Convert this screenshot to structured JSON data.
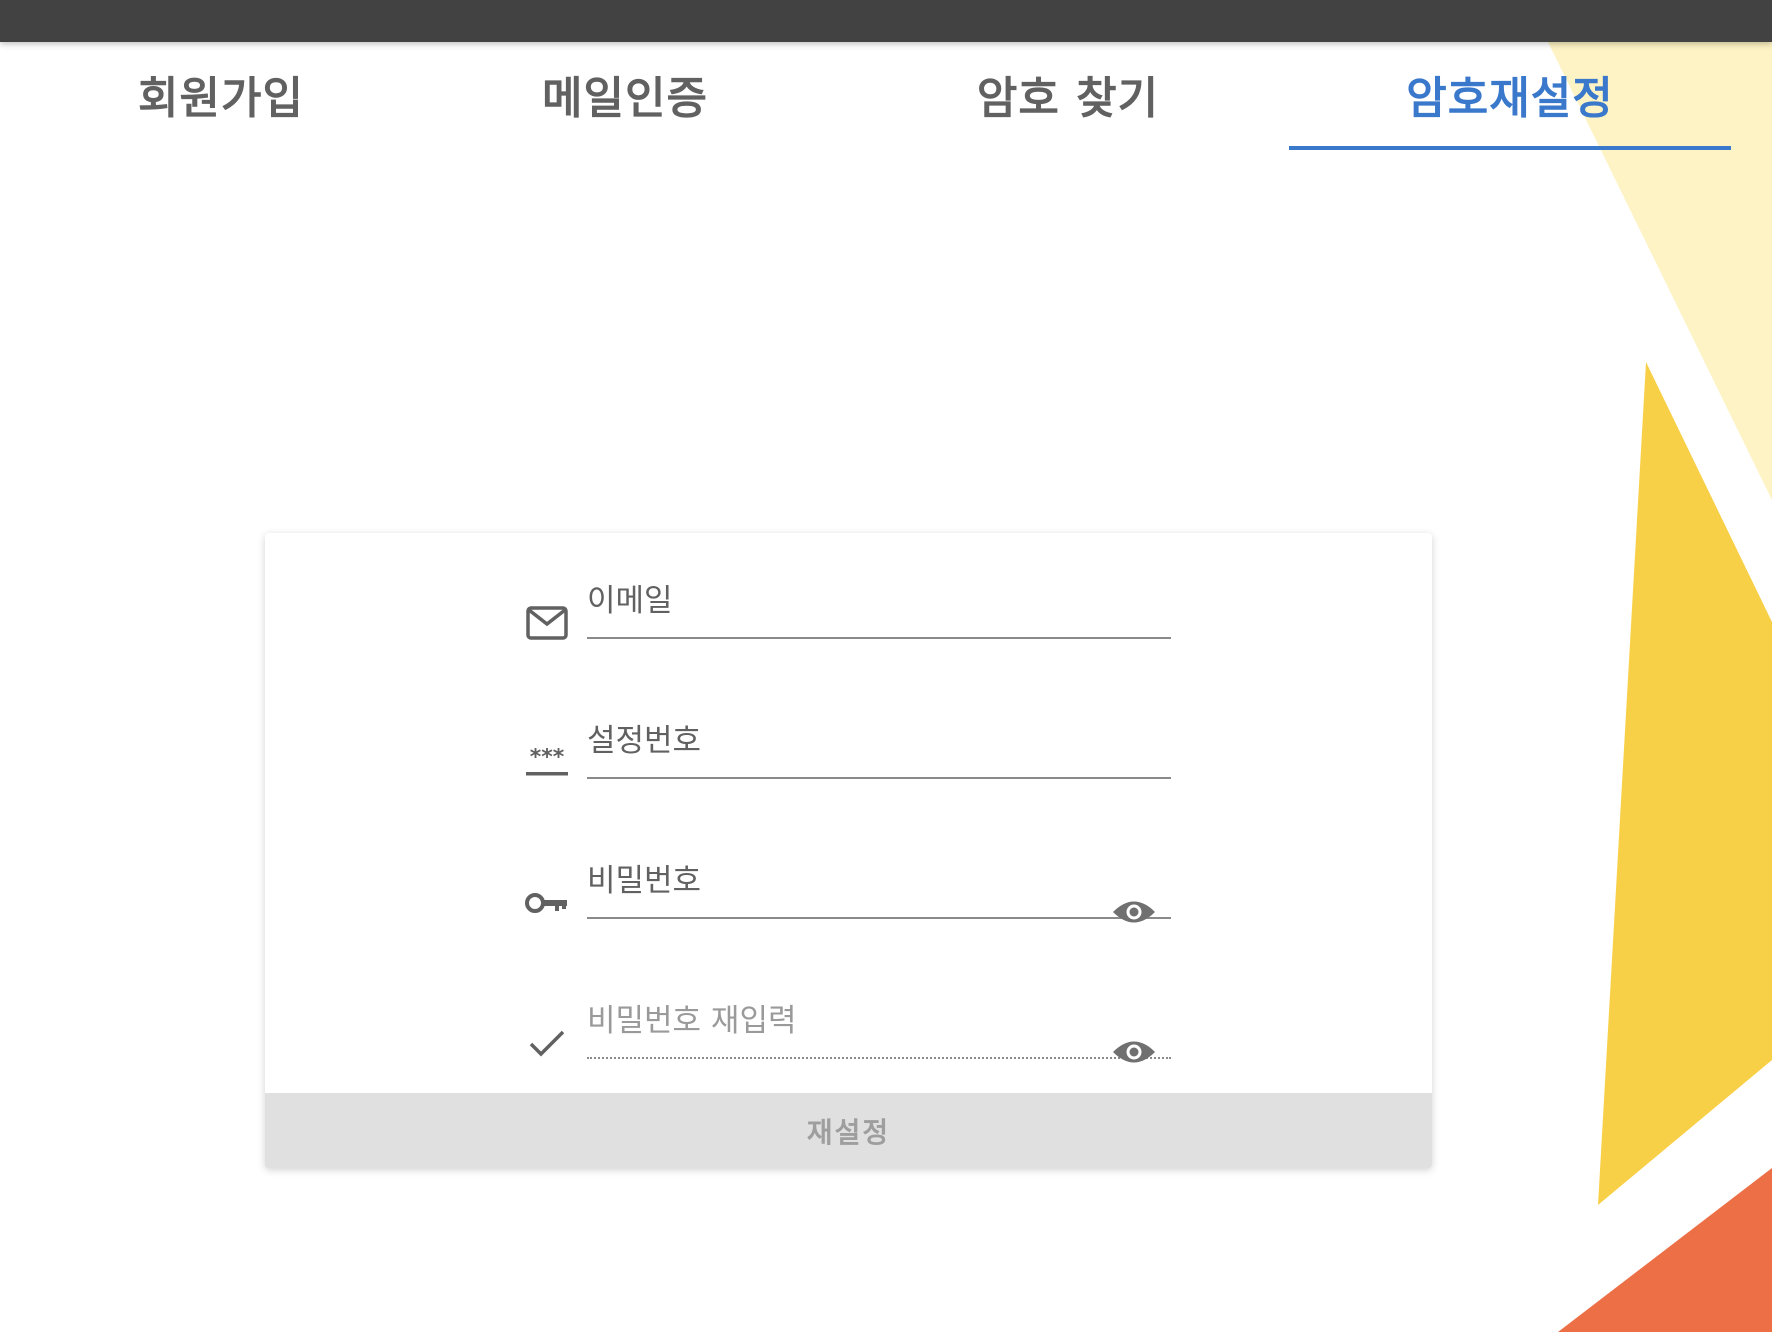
{
  "tabs": [
    {
      "label": "회원가입",
      "active": false
    },
    {
      "label": "메일인증",
      "active": false
    },
    {
      "label": "암호 찾기",
      "active": false
    },
    {
      "label": "암호재설정",
      "active": true
    }
  ],
  "form": {
    "fields": [
      {
        "placeholder": "이메일",
        "icon": "mail-icon",
        "value": ""
      },
      {
        "placeholder": "설정번호",
        "icon": "password-dots-icon",
        "value": ""
      },
      {
        "placeholder": "비밀번호",
        "icon": "key-icon",
        "value": "",
        "toggle_icon": "eye-icon"
      },
      {
        "placeholder": "비밀번호 재입력",
        "icon": "check-icon",
        "value": "",
        "toggle_icon": "eye-icon"
      }
    ],
    "submit_label": "재설정"
  },
  "colors": {
    "topbar": "#424242",
    "accent": "#3a78cc",
    "tab_inactive": "#616161",
    "deco_light_yellow": "#fdf3c4",
    "deco_yellow": "#f8d047",
    "deco_orange": "#ec6f46",
    "button_disabled_bg": "#e0e0e0",
    "button_disabled_text": "#9e9e9e"
  }
}
